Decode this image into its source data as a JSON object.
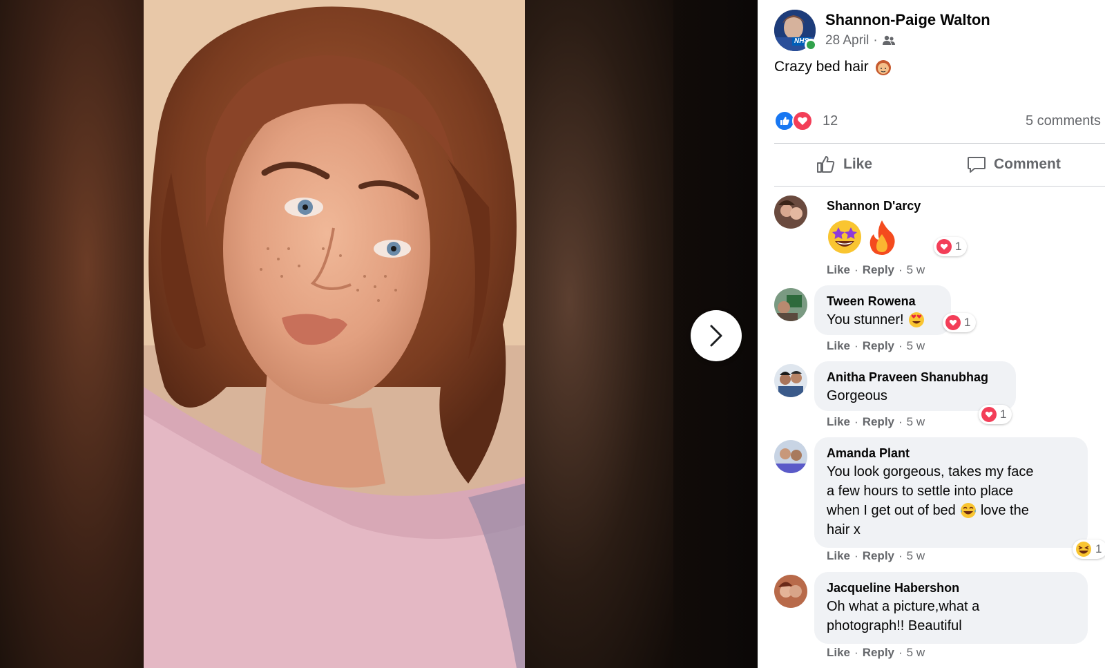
{
  "viewer": {
    "next_label": "›"
  },
  "post": {
    "author": "Shannon-Paige Walton",
    "avatar_badge": "NHS",
    "date": "28 April",
    "audience_icon": "friends-icon",
    "text": "Crazy bed hair",
    "text_emoji": "woman-red-hair-emoji",
    "reaction_count": "12",
    "comments_count": "5 comments",
    "like_label": "Like",
    "comment_label": "Comment"
  },
  "comments": [
    {
      "name": "Shannon D'arcy",
      "text": "",
      "emojis": [
        "star-struck-emoji",
        "fire-emoji"
      ],
      "reaction_count": "1",
      "reaction": "love",
      "like": "Like",
      "reply": "Reply",
      "time": "5 w"
    },
    {
      "name": "Tween Rowena",
      "text": "You stunner!",
      "emojis": [
        "heart-eyes-emoji"
      ],
      "reaction_count": "1",
      "reaction": "love",
      "like": "Like",
      "reply": "Reply",
      "time": "5 w"
    },
    {
      "name": "Anitha Praveen Shanubhag",
      "text": "Gorgeous",
      "reaction_count": "1",
      "reaction": "love",
      "like": "Like",
      "reply": "Reply",
      "time": "5 w"
    },
    {
      "name": "Amanda Plant",
      "text_lines": [
        "You look gorgeous, takes my face",
        "a few hours to settle into place",
        "when I get out of bed",
        "love the",
        "hair x"
      ],
      "reaction_count": "1",
      "reaction": "haha",
      "like": "Like",
      "reply": "Reply",
      "time": "5 w"
    },
    {
      "name": "Jacqueline Habershon",
      "text_lines": [
        "Oh what a picture,what a",
        "photograph!! Beautiful"
      ],
      "like": "Like",
      "reply": "Reply",
      "time": "5 w"
    }
  ],
  "colors": {
    "accent": "#1877f2",
    "love": "#f33e58",
    "secondary_text": "#65676b",
    "bubble": "#f0f2f5",
    "online": "#31a24c"
  }
}
